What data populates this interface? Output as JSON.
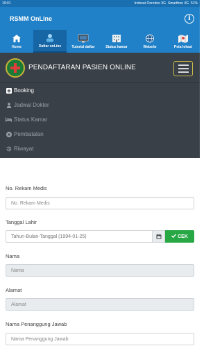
{
  "status_bar": {
    "time": "19:01",
    "carrier1": "Indosat Ooredoo 3G",
    "carrier2": "Smartfren 4G",
    "battery": "51%"
  },
  "app": {
    "title": "RSMM OnLine"
  },
  "tabs": [
    {
      "label": "Home",
      "icon": "home-icon"
    },
    {
      "label": "Daftar onLine",
      "icon": "register-icon",
      "active": true
    },
    {
      "label": "Tutorial daftar",
      "icon": "tutorial-icon"
    },
    {
      "label": "Status kamar",
      "icon": "room-status-icon"
    },
    {
      "label": "Website",
      "icon": "website-icon"
    },
    {
      "label": "Peta lokasi",
      "icon": "map-icon"
    }
  ],
  "navbar": {
    "brand": "PENDAFTARAN PASIEN ONLINE",
    "menu": [
      {
        "label": "Booking",
        "icon": "plus-square-icon",
        "active": true
      },
      {
        "label": "Jadwal Dokter",
        "icon": "user-md-icon"
      },
      {
        "label": "Status Kamar",
        "icon": "bed-icon"
      },
      {
        "label": "Pembatalan",
        "icon": "times-circle-icon"
      },
      {
        "label": "Riwayat",
        "icon": "history-icon"
      }
    ]
  },
  "form": {
    "rekam_medis": {
      "label": "No. Rekam Medis",
      "placeholder": "No. Rekam Medis"
    },
    "tanggal_lahir": {
      "label": "Tanggal Lahir",
      "placeholder": "Tahun-Bulan-Tanggal (1994-01-25)",
      "button": "CEK"
    },
    "nama": {
      "label": "Nama",
      "placeholder": "Nama"
    },
    "alamat": {
      "label": "Alamat",
      "placeholder": "Alamat"
    },
    "penanggung": {
      "label": "Nama Penanggung Jawab",
      "placeholder": "Nama Penanggung Jawab"
    }
  },
  "colors": {
    "primary": "#2181c8",
    "navbar": "#3a4047",
    "success": "#28a745"
  }
}
